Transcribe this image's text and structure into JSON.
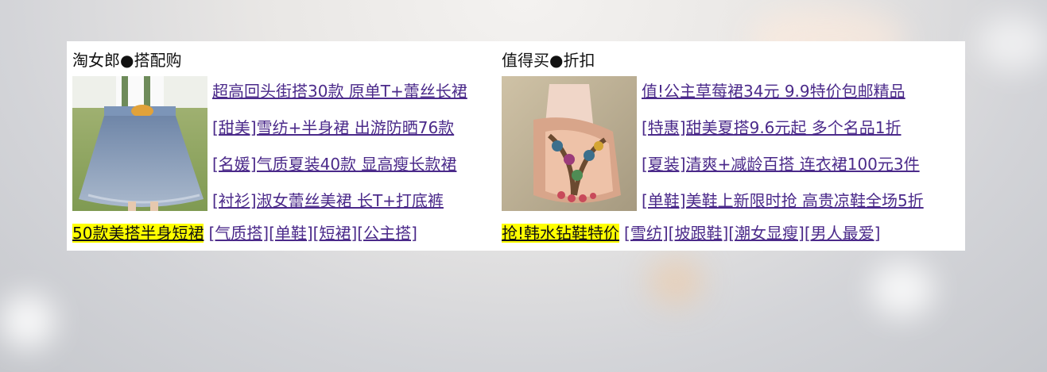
{
  "left": {
    "title": "淘女郎●搭配购",
    "links": [
      "超高回头街搭30款 原单T+蕾丝长裙",
      "[甜美]雪纺+半身裙 出游防晒76款",
      "[名媛]气质夏装40款 显高瘦长款裙",
      "[衬衫]淑女蕾丝美裙 长T+打底裤"
    ],
    "highlight": "50款美搭半身短裙",
    "tags": [
      "[气质搭]",
      "[单鞋]",
      "[短裙]",
      "[公主搭]"
    ]
  },
  "right": {
    "title": "值得买●折扣",
    "links": [
      "值!公主草莓裙34元 9.9特价包邮精品",
      "[特惠]甜美夏搭9.6元起 多个名品1折",
      "[夏装]清爽+减龄百搭 连衣裙100元3件",
      "[单鞋]美鞋上新限时抢 高贵凉鞋全场5折"
    ],
    "highlight": "抢!韩水钻鞋特价",
    "tags": [
      "[雪纺]",
      "[坡跟鞋]",
      "[潮女显瘦]",
      "[男人最爱]"
    ]
  }
}
